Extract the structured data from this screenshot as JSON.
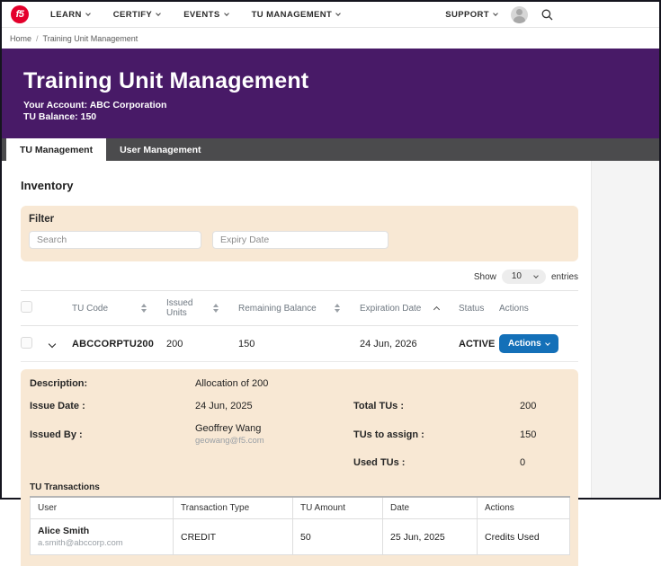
{
  "brand": {
    "logo_text": "f5",
    "logo_color": "#e4002b"
  },
  "nav": {
    "items": [
      {
        "label": "LEARN"
      },
      {
        "label": "CERTIFY"
      },
      {
        "label": "EVENTS"
      },
      {
        "label": "TU MANAGEMENT"
      }
    ],
    "support_label": "SUPPORT"
  },
  "breadcrumb": {
    "home": "Home",
    "separator": "/",
    "current": "Training Unit Management"
  },
  "hero": {
    "title": "Training Unit Management",
    "account_line": "Your Account: ABC Corporation",
    "balance_line": "TU Balance: 150",
    "bg_color": "#481a67"
  },
  "tabs": [
    {
      "label": "TU Management",
      "active": true
    },
    {
      "label": "User Management",
      "active": false
    }
  ],
  "inventory": {
    "heading": "Inventory",
    "filter": {
      "title": "Filter",
      "search_placeholder": "Search",
      "expiry_placeholder": "Expiry Date"
    },
    "show_entries": {
      "prefix": "Show",
      "value": "10",
      "suffix": "entries"
    },
    "table": {
      "columns": [
        "TU Code",
        "Issued Units",
        "Remaining Balance",
        "Expiration Date",
        "Status",
        "Actions"
      ],
      "rows": [
        {
          "tu_code": "ABCCORPTU200",
          "issued_units": "200",
          "remaining_balance": "150",
          "expiration_date": "24 Jun, 2026",
          "status": "ACTIVE",
          "actions_label": "Actions"
        }
      ]
    }
  },
  "detail": {
    "description_label": "Description:",
    "description_value": "Allocation of 200",
    "issue_date_label": "Issue Date :",
    "issue_date_value": "24 Jun, 2025",
    "issued_by_label": "Issued By :",
    "issued_by_name": "Geoffrey Wang",
    "issued_by_email": "geowang@f5.com",
    "total_tus_label": "Total TUs :",
    "total_tus_value": "200",
    "tus_to_assign_label": "TUs to assign :",
    "tus_to_assign_value": "150",
    "used_tus_label": "Used TUs :",
    "used_tus_value": "0",
    "transactions": {
      "title": "TU Transactions",
      "columns": [
        "User",
        "Transaction Type",
        "TU Amount",
        "Date",
        "Actions"
      ],
      "rows": [
        {
          "user_name": "Alice Smith",
          "user_email": "a.smith@abccorp.com",
          "transaction_type": "CREDIT",
          "tu_amount": "50",
          "date": "25 Jun, 2025",
          "actions": "Credits Used"
        }
      ]
    }
  },
  "colors": {
    "purple": "#481a67",
    "tabbar_gray": "#4b4b4d",
    "panel_tan": "#f8e8d4",
    "button_blue": "#1470b8",
    "brand_red": "#e4002b",
    "rail_gray": "#f4f4f4"
  }
}
